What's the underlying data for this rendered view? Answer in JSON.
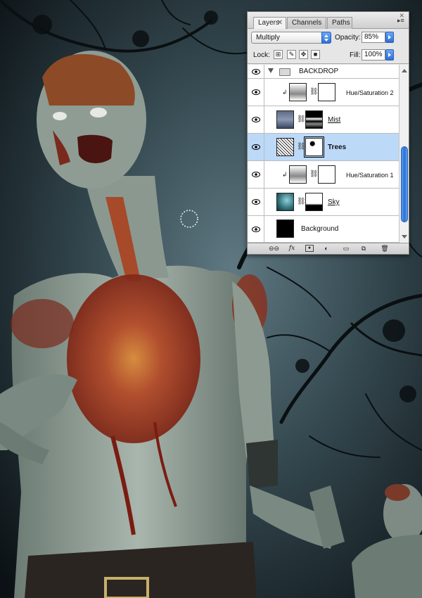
{
  "panel": {
    "tabs": [
      {
        "label": "Layers",
        "active": true
      },
      {
        "label": "Channels",
        "active": false
      },
      {
        "label": "Paths",
        "active": false
      }
    ],
    "blend_mode": "Multiply",
    "opacity_label": "Opacity:",
    "opacity_value": "85%",
    "lock_label": "Lock:",
    "fill_label": "Fill:",
    "fill_value": "100%",
    "layers": [
      {
        "name": "BACKDROP",
        "type": "group",
        "visible": true,
        "expanded": true
      },
      {
        "name": "Hue/Saturation 2",
        "type": "adjustment",
        "visible": true,
        "clipped": true
      },
      {
        "name": "Mist",
        "type": "image",
        "visible": true,
        "underlined": true
      },
      {
        "name": "Trees",
        "type": "image",
        "visible": true,
        "selected": true
      },
      {
        "name": "Hue/Saturation 1",
        "type": "adjustment",
        "visible": true,
        "clipped": true
      },
      {
        "name": "Sky",
        "type": "image",
        "visible": true,
        "underlined": true
      },
      {
        "name": "Background",
        "type": "background",
        "visible": true
      }
    ],
    "bottom_icons": [
      "link-icon",
      "fx-icon",
      "mask-icon",
      "adjustment-icon",
      "folder-icon",
      "new-layer-icon",
      "trash-icon"
    ]
  },
  "colors": {
    "selection": "#bcd9f8",
    "accent_blue": "#2e6fd8",
    "sky_dark": "#0d1417"
  }
}
